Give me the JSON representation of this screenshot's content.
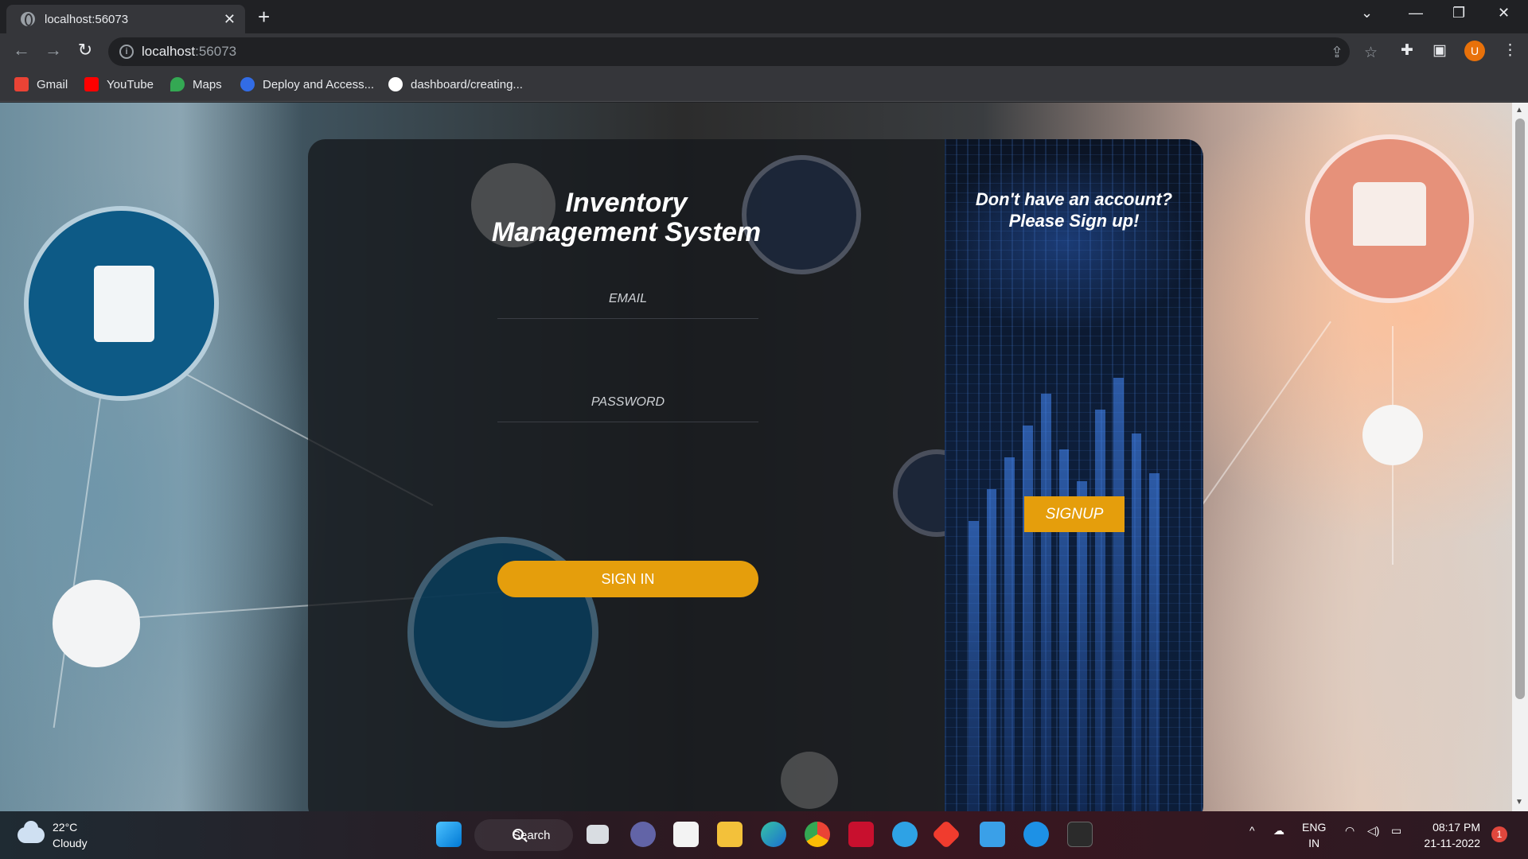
{
  "browser": {
    "tab_title": "localhost:56073",
    "new_tab_symbol": "+",
    "close_symbol": "✕",
    "url_host": "localhost",
    "url_port": ":56073",
    "bookmarks": [
      {
        "label": "Gmail",
        "icon": "gmail-icon",
        "color": "#ea4335"
      },
      {
        "label": "YouTube",
        "icon": "youtube-icon",
        "color": "#ff0000"
      },
      {
        "label": "Maps",
        "icon": "maps-icon",
        "color": "#34a853"
      },
      {
        "label": "Deploy and Access...",
        "icon": "kubernetes-icon",
        "color": "#326ce5"
      },
      {
        "label": "dashboard/creating...",
        "icon": "github-icon",
        "color": "#ffffff"
      }
    ],
    "profile_initial": "U"
  },
  "login": {
    "title_line1": "Inventory",
    "title_line2": "Management System",
    "email_placeholder": "EMAIL",
    "password_placeholder": "PASSWORD",
    "signin_label": "SIGN IN"
  },
  "signup": {
    "prompt_line1": "Don't have an account?",
    "prompt_line2": "Please Sign up!",
    "button_label": "SIGNUP"
  },
  "colors": {
    "accent": "#e59e0c",
    "card_dark": "#16181c",
    "signup_panel": "#0d1e3a"
  },
  "taskbar": {
    "temperature": "22°C",
    "weather": "Cloudy",
    "search_label": "Search",
    "lang_line1": "ENG",
    "lang_line2": "IN",
    "time": "08:17 PM",
    "date": "21-11-2022",
    "notification_count": "1"
  }
}
